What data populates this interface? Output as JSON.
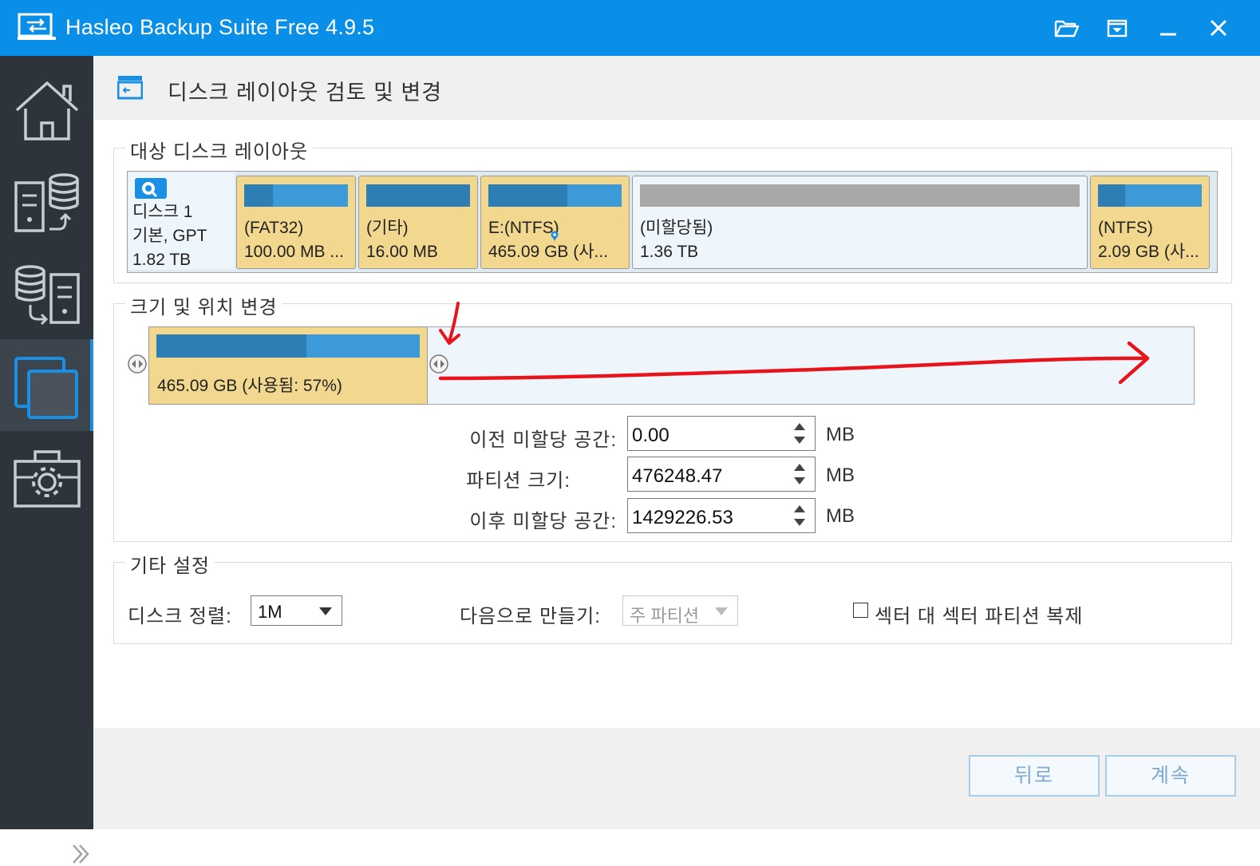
{
  "window": {
    "title": "Hasleo Backup Suite Free 4.9.5"
  },
  "titlebar_icons": [
    "open-folder-icon",
    "restore-icon",
    "minimize-icon",
    "close-icon"
  ],
  "sidebar": {
    "items": [
      {
        "icon": "home-icon",
        "active": false
      },
      {
        "icon": "backup-icon",
        "active": false
      },
      {
        "icon": "restore-icon",
        "active": false
      },
      {
        "icon": "clone-icon",
        "active": true
      },
      {
        "icon": "tools-icon",
        "active": false
      }
    ]
  },
  "header": {
    "title": "디스크 레이아웃 검토 및 변경"
  },
  "target_layout": {
    "legend": "대상 디스크 레이아웃",
    "disk": {
      "name": "디스크 1",
      "type": "기본, GPT",
      "size": "1.82 TB"
    },
    "partitions": [
      {
        "name": "(FAT32)",
        "size": "100.00 MB ...",
        "used": 0.25
      },
      {
        "name": "(기타)",
        "size": "16.00 MB",
        "used": 1.0
      },
      {
        "name": "E:(NTFS)",
        "size": "465.09 GB (사...",
        "used": 0.57
      },
      {
        "name": "(미할당됨)",
        "size": "1.36 TB",
        "used": 0
      },
      {
        "name": "(NTFS)",
        "size": "2.09 GB (사...",
        "used": 0.24
      }
    ]
  },
  "resize": {
    "legend": "크기 및 위치 변경",
    "partition_label": "465.09 GB (사용됨: 57%)",
    "used": 0.57,
    "fields": [
      {
        "label": "이전 미할당 공간:",
        "value": "0.00",
        "unit": "MB"
      },
      {
        "label": "파티션 크기:",
        "value": "476248.47",
        "unit": "MB"
      },
      {
        "label": "이후 미할당 공간:",
        "value": "1429226.53",
        "unit": "MB"
      }
    ]
  },
  "other": {
    "legend": "기타 설정",
    "alignment_label": "디스크 정렬:",
    "alignment_value": "1M",
    "create_as_label": "다음으로 만들기:",
    "create_as_value": "주 파티션",
    "sector_label": "섹터 대 섹터 파티션 복제",
    "sector_checked": false
  },
  "footer": {
    "back_label": "뒤로",
    "next_label": "계속"
  },
  "colors": {
    "titlebar": "#0a8fe8",
    "sidebar": "#2d343c",
    "partition": "#f2d88e",
    "bar_used": "#2e7eb6",
    "bar_free": "#3c9ad8",
    "annotation": "#e8141b"
  }
}
